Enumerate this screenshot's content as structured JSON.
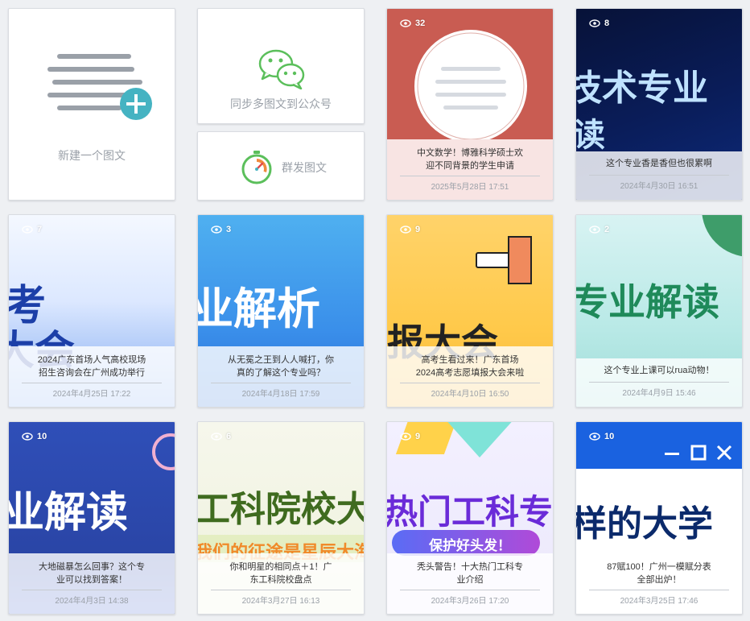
{
  "actions": {
    "new_post": "新建一个图文",
    "sync_to_mp": "同步多图文到公众号",
    "mass_send": "群发图文"
  },
  "colors": {
    "accent_teal": "#45b3c2",
    "wechat_green": "#5bbf5b"
  },
  "posts": [
    {
      "views": "32",
      "title_line1": "中文数学！博雅科学硕士欢",
      "title_line2": "迎不同背景的学生申请",
      "date": "2025年5月28日 17:51"
    },
    {
      "views": "8",
      "banner": "技术专业",
      "banner2": "读",
      "title_line1": "这个专业香是香但也很累啊",
      "title_line2": "",
      "date": "2024年4月30日 16:51"
    },
    {
      "views": "7",
      "banner": "考",
      "banner2": "大会",
      "title_line1": "2024广东首场人气高校现场",
      "title_line2": "招生咨询会在广州成功举行",
      "date": "2024年4月25日 17:22"
    },
    {
      "views": "3",
      "banner": "业解析",
      "title_line1": "从无冕之王到人人喊打，你",
      "title_line2": "真的了解这个专业吗？",
      "date": "2024年4月18日 17:59"
    },
    {
      "views": "9",
      "banner": "报大会",
      "title_line1": "高考生看过来！广东首场",
      "title_line2": "2024高考志愿填报大会来啦",
      "date": "2024年4月10日 16:50"
    },
    {
      "views": "2",
      "banner": "专业解读",
      "title_line1": "这个专业上课可以rua动物！",
      "title_line2": "",
      "date": "2024年4月9日 15:46"
    },
    {
      "views": "10",
      "banner": "业解读",
      "title_line1": "大地磁暴怎么回事？这个专",
      "title_line2": "业可以找到答案！",
      "date": "2024年4月3日 14:38"
    },
    {
      "views": "6",
      "banner": "工科院校大",
      "banner2": "我们的征途是星辰大海",
      "title_line1": "你和明星的相同点＋1！广",
      "title_line2": "东工科院校盘点",
      "date": "2024年3月27日 16:13"
    },
    {
      "views": "9",
      "banner": "热门工科专",
      "banner2": "保护好头发！",
      "title_line1": "秃头警告！十大热门工科专",
      "title_line2": "业介绍",
      "date": "2024年3月26日 17:20"
    },
    {
      "views": "10",
      "banner": "样的大学",
      "title_line1": "87赋100！广州一模赋分表",
      "title_line2": "全部出炉！",
      "date": "2024年3月25日 17:46"
    }
  ]
}
